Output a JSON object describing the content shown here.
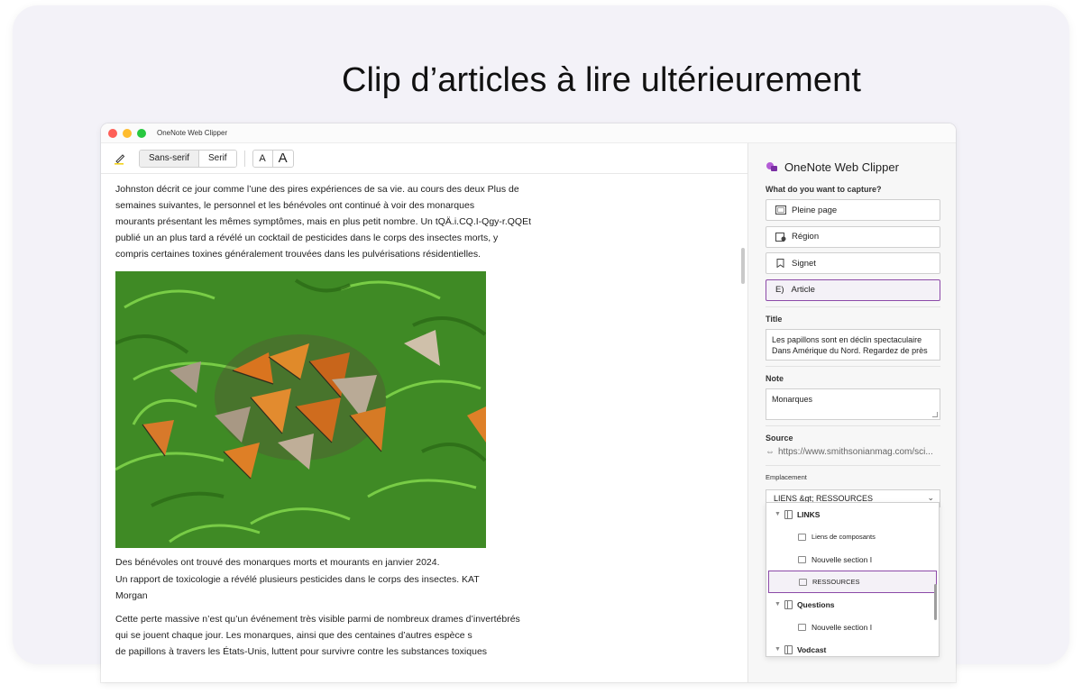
{
  "headline": "Clip d’articles à lire ultérieurement",
  "window": {
    "title": "OneNote Web Clipper"
  },
  "toolbar": {
    "font_sans": "Sans-serif",
    "font_serif": "Serif",
    "size_small": "A",
    "size_large": "A"
  },
  "article": {
    "para1": [
      "Johnston décrit ce jour comme l’une des pires expériences de sa vie. au cours des deux       Plus de",
      "semaines suivantes, le personnel et les bénévoles ont continué à voir des monarques",
      "mourants présentant les mêmes symptômes, mais en plus petit nombre. Un tQÄ.i.CQ.I-Qgy-r.QQEt",
      "publié un an plus tard a révélé un cocktail de pesticides dans le corps des insectes morts, y",
      "compris certaines toxines généralement trouvées dans les pulvérisations résidentielles."
    ],
    "caption_line1": "Des bénévoles ont trouvé des monarques morts et mourants en janvier 2024.",
    "caption_line2": "Un rapport de toxicologie a révélé plusieurs pesticides dans le corps des insectes.        KAT",
    "caption_line3": "Morgan",
    "para2": [
      "Cette perte massive n’est qu’un événement très visible parmi de nombreux drames d’invertébrés",
      "qui se jouent chaque jour. Les monarques, ainsi que des centaines d’autres espèce s",
      "de papillons à travers les États-Unis, luttent pour survivre contre les substances toxiques"
    ]
  },
  "clipper": {
    "title": "OneNote Web Clipper",
    "capture_label": "What do you want to capture?",
    "modes": [
      "Pleine page",
      "Région",
      "Signet",
      "Article"
    ],
    "article_prefix": "E)",
    "title_label": "Title",
    "title_value": "Les papillons sont en déclin spectaculaire Dans Amérique du Nord. Regardez de près",
    "note_label": "Note",
    "note_value": "Monarques",
    "source_label": "Source",
    "source_value": "https://www.smithsonianmag.com/sci...",
    "location_label": "Emplacement",
    "location_value": "LIENS &gt; RESSOURCES",
    "tree": [
      {
        "label": "LINKS",
        "type": "group"
      },
      {
        "label": "Liens de composants",
        "type": "child"
      },
      {
        "label": "Nouvelle section I",
        "type": "child"
      },
      {
        "label": "RESSOURCES",
        "type": "child",
        "selected": true
      },
      {
        "label": "Questions",
        "type": "group"
      },
      {
        "label": "Nouvelle section I",
        "type": "child"
      },
      {
        "label": "Vodcast",
        "type": "group"
      }
    ]
  },
  "colors": {
    "accent": "#8c4aa8",
    "card_bg": "#f3f2f8"
  }
}
